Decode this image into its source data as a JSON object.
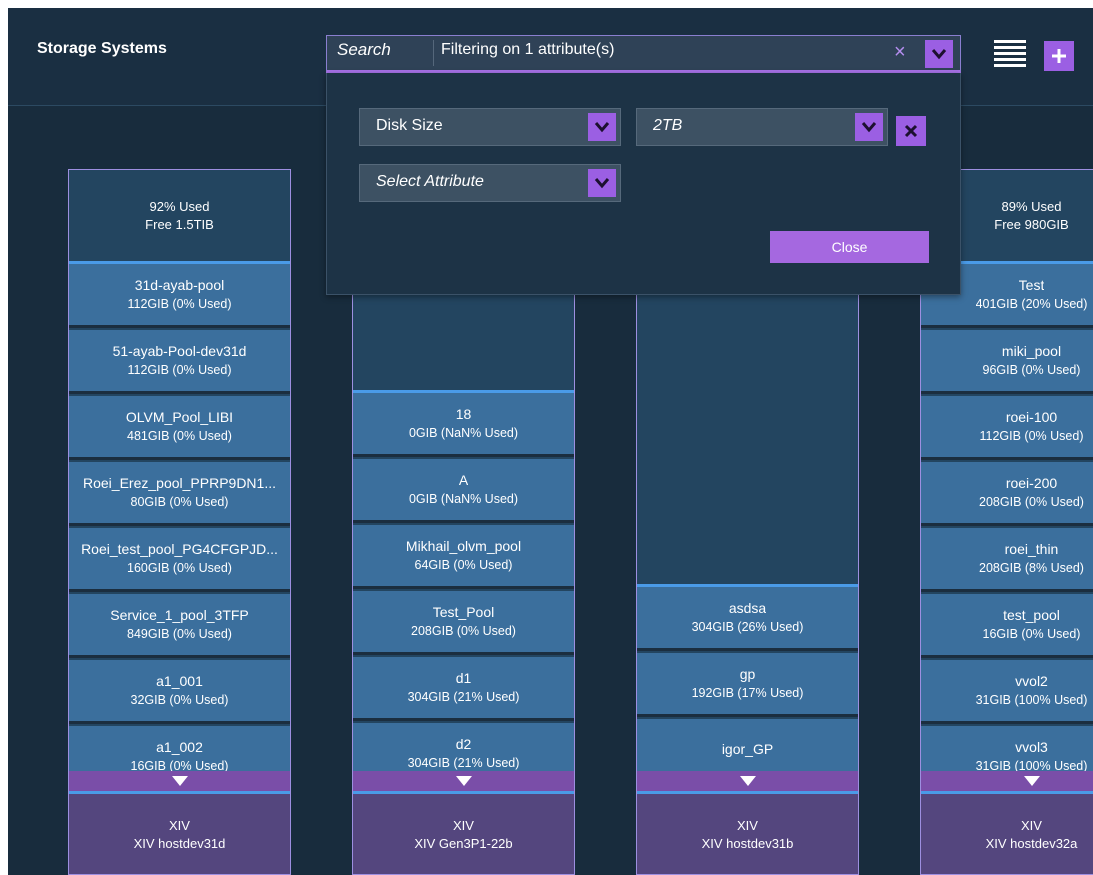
{
  "header": {
    "title": "Storage Systems",
    "search_label": "Search",
    "search_text": "Filtering on 1 attribute(s)",
    "clear_glyph": "×"
  },
  "filter_panel": {
    "attribute_value": "Disk Size",
    "filter_value": "2TB",
    "add_attribute_placeholder": "Select Attribute",
    "close_label": "Close"
  },
  "colors": {
    "background": "#182c3d",
    "accent_purple": "#9b5fe3",
    "pool_blue": "#3b6f9d",
    "footer_purple": "#54467e",
    "divider_blue": "#4a9be8"
  },
  "columns": [
    {
      "used": "92% Used",
      "free": "Free 1.5TIB",
      "pools": [
        {
          "name": "31d-ayab-pool",
          "size": "112GIB (0% Used)"
        },
        {
          "name": "51-ayab-Pool-dev31d",
          "size": "112GIB (0% Used)"
        },
        {
          "name": "OLVM_Pool_LIBI",
          "size": "481GIB (0% Used)"
        },
        {
          "name": "Roei_Erez_pool_PPRP9DN1...",
          "size": "80GIB (0% Used)"
        },
        {
          "name": "Roei_test_pool_PG4CFGPJD...",
          "size": "160GIB (0% Used)"
        },
        {
          "name": "Service_1_pool_3TFP",
          "size": "849GIB (0% Used)"
        },
        {
          "name": "a1_001",
          "size": "32GIB (0% Used)"
        },
        {
          "name": "a1_002",
          "size": "16GIB (0% Used)"
        }
      ],
      "type": "XIV",
      "host": "XIV hostdev31d"
    },
    {
      "used": "",
      "free": "",
      "pools": [
        {
          "name": "18",
          "size": "0GIB (NaN% Used)"
        },
        {
          "name": "A",
          "size": "0GIB (NaN% Used)"
        },
        {
          "name": "Mikhail_olvm_pool",
          "size": "64GIB (0% Used)"
        },
        {
          "name": "Test_Pool",
          "size": "208GIB (0% Used)"
        },
        {
          "name": "d1",
          "size": "304GIB (21% Used)"
        },
        {
          "name": "d2",
          "size": "304GIB (21% Used)"
        }
      ],
      "type": "XIV",
      "host": "XIV Gen3P1-22b"
    },
    {
      "used": "",
      "free": "",
      "pools": [
        {
          "name": "asdsa",
          "size": "304GIB (26% Used)"
        },
        {
          "name": "gp",
          "size": "192GIB (17% Used)"
        },
        {
          "name": "igor_GP",
          "size": ""
        }
      ],
      "type": "XIV",
      "host": "XIV hostdev31b"
    },
    {
      "used": "89% Used",
      "free": "Free 980GIB",
      "pools": [
        {
          "name": "Test",
          "size": "401GIB (20% Used)"
        },
        {
          "name": "miki_pool",
          "size": "96GIB (0% Used)"
        },
        {
          "name": "roei-100",
          "size": "112GIB (0% Used)"
        },
        {
          "name": "roei-200",
          "size": "208GIB (0% Used)"
        },
        {
          "name": "roei_thin",
          "size": "208GIB (8% Used)"
        },
        {
          "name": "test_pool",
          "size": "16GIB (0% Used)"
        },
        {
          "name": "vvol2",
          "size": "31GIB (100% Used)"
        },
        {
          "name": "vvol3",
          "size": "31GIB (100% Used)"
        }
      ],
      "type": "XIV",
      "host": "XIV hostdev32a"
    }
  ]
}
